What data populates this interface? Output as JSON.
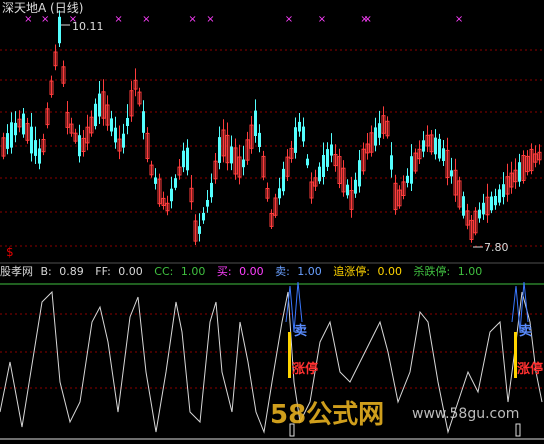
{
  "header": {
    "title": "深天地A (日线)",
    "high_label": "10.11",
    "low_label": "7.80",
    "signal_mark": "$"
  },
  "colors": {
    "up": "#ff3c3c",
    "down": "#54ffff",
    "grid": "#8b0000",
    "star": "#ff40ff",
    "indicator_line": "#d8d8d8",
    "green_line": "#40c040",
    "buy_line": "#3a78ff",
    "yellow": "#ffd400"
  },
  "main_chart": {
    "y_high": 10.11,
    "y_low": 7.8,
    "star_positions": [
      0.052,
      0.083,
      0.134,
      0.218,
      0.269,
      0.354,
      0.387,
      0.531,
      0.592,
      0.67,
      0.676,
      0.844
    ]
  },
  "indicator": {
    "name": "股孝网",
    "items": [
      {
        "key": "B",
        "label": "B:",
        "value": "0.89",
        "color": "#d8d8d8"
      },
      {
        "key": "FF",
        "label": "FF:",
        "value": "0.00",
        "color": "#d8d8d8"
      },
      {
        "key": "CC",
        "label": "CC:",
        "value": "1.00",
        "color": "#40c040"
      },
      {
        "key": "buy",
        "label": "买:",
        "value": "0.00",
        "color": "#ff40ff"
      },
      {
        "key": "sell",
        "label": "卖:",
        "value": "1.00",
        "color": "#6aa0ff"
      },
      {
        "key": "chase",
        "label": "追涨停:",
        "value": "0.00",
        "color": "#ffd400"
      },
      {
        "key": "kill",
        "label": "杀跌停:",
        "value": "1.00",
        "color": "#40c040"
      }
    ],
    "signal_sell": "卖",
    "signal_limit_up": "涨停"
  },
  "watermark": {
    "text": "58公式网",
    "url": "www.58gu.com"
  }
}
